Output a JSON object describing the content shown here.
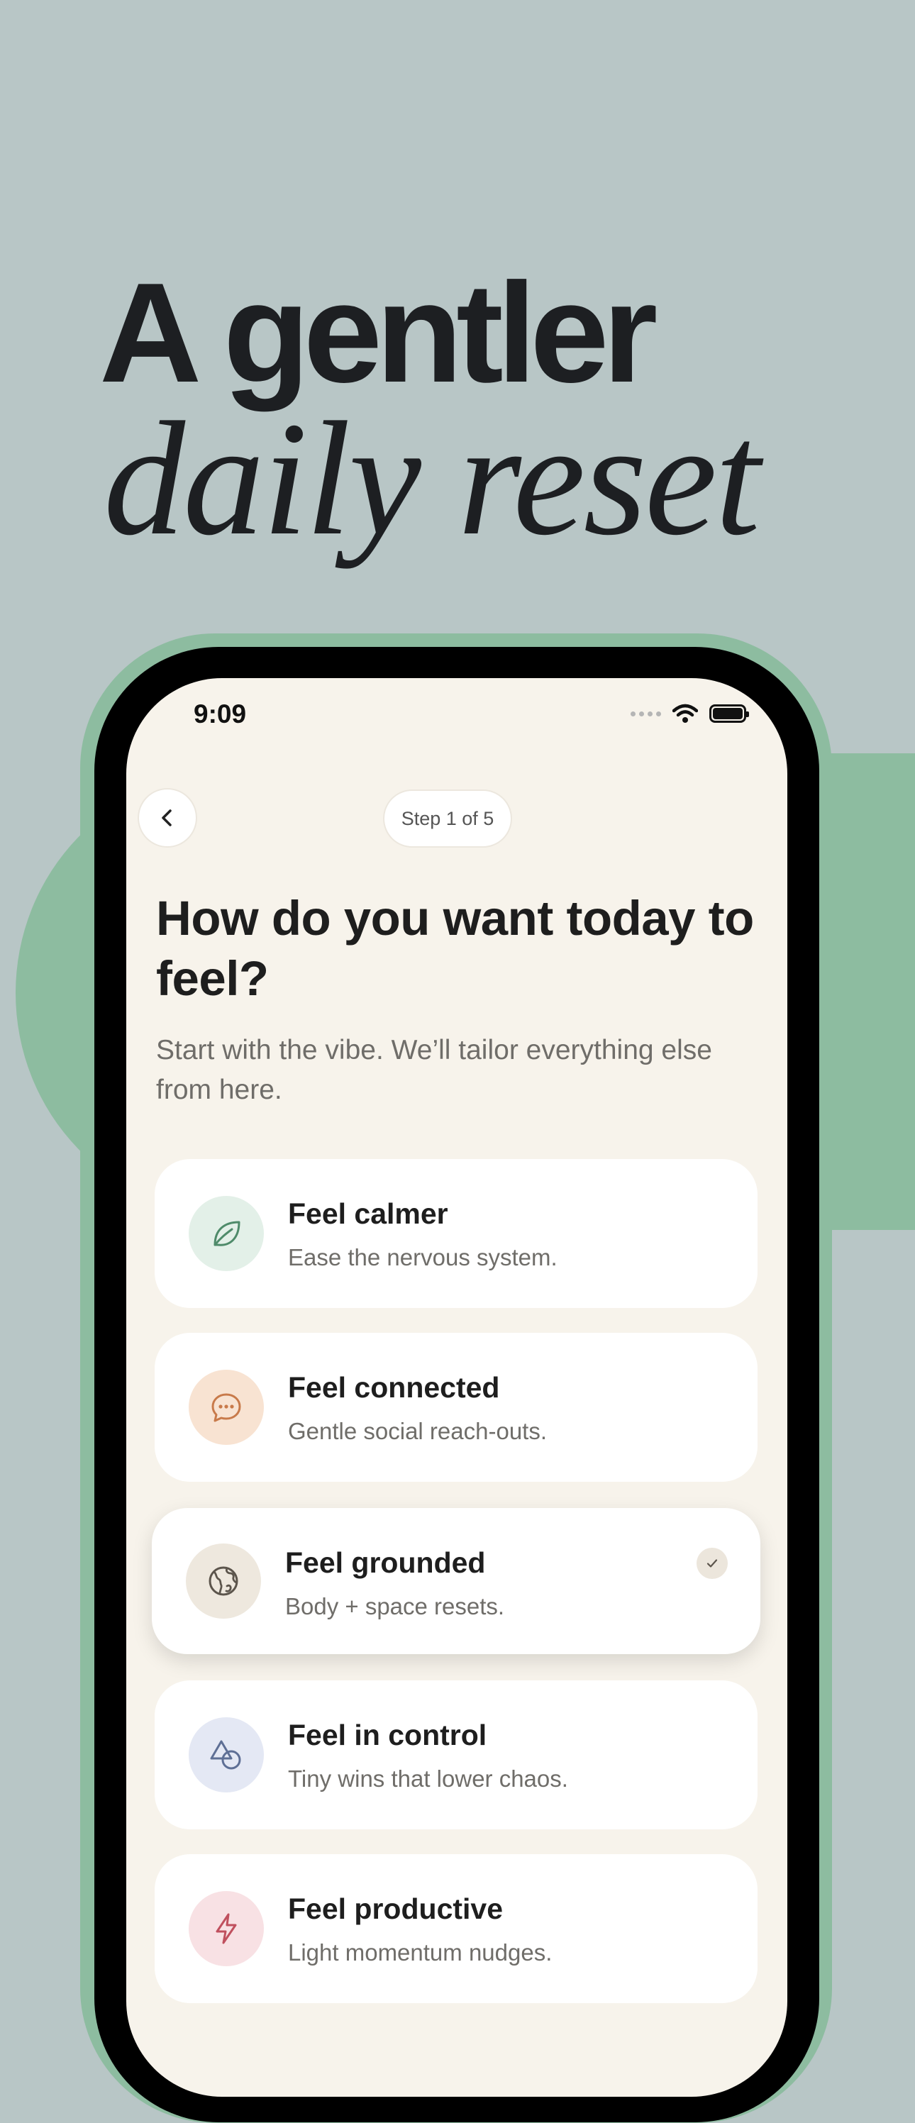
{
  "hero": {
    "line1": "A gentler",
    "line2": "daily reset"
  },
  "status_bar": {
    "time": "9:09"
  },
  "nav": {
    "step": "Step 1 of 5"
  },
  "question": {
    "title": "How do you want today to feel?",
    "subtitle": "Start with the vibe. We’ll tailor everything else from here."
  },
  "options": [
    {
      "title": "Feel calmer",
      "desc": "Ease the nervous system.",
      "icon": "leaf-icon",
      "color": "#e3f0e8",
      "stroke": "#4f8b6a",
      "selected": false
    },
    {
      "title": "Feel connected",
      "desc": "Gentle social reach-outs.",
      "icon": "chat-bubble-icon",
      "color": "#f8e3d2",
      "stroke": "#c87a4a",
      "selected": false
    },
    {
      "title": "Feel grounded",
      "desc": "Body + space resets.",
      "icon": "globe-icon",
      "color": "#eee8de",
      "stroke": "#5c554c",
      "selected": true
    },
    {
      "title": "Feel in control",
      "desc": "Tiny wins that lower chaos.",
      "icon": "shapes-icon",
      "color": "#e4e8f4",
      "stroke": "#5e6f95",
      "selected": false
    },
    {
      "title": "Feel productive",
      "desc": "Light momentum nudges.",
      "icon": "lightning-icon",
      "color": "#f8e1e4",
      "stroke": "#c0505e",
      "selected": false
    }
  ],
  "colors": {
    "background": "#b8c6c6",
    "accent_green": "#8dbca0",
    "screen": "#f7f3eb"
  }
}
